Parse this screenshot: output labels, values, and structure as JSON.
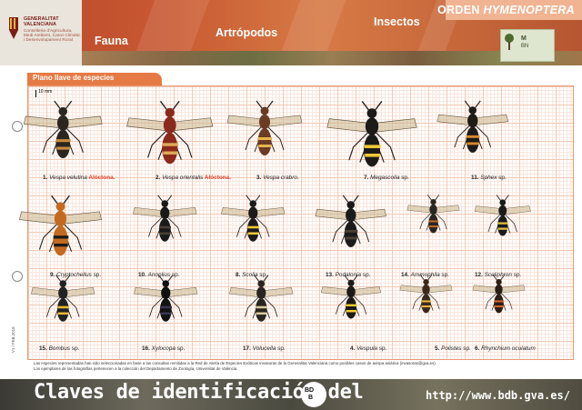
{
  "header": {
    "logo_lines": [
      "GENERALITAT",
      "VALENCIANA"
    ],
    "logo_sub_lines": [
      "Conselleria d'Agricultura,",
      "Medi Ambient, Canvi Climàtic",
      "i Desenvolupament Rural"
    ],
    "crumbs": [
      "Fauna",
      "Artrópodos",
      "Insectos"
    ],
    "orden_prefix": "ORDEN",
    "orden_name": "HYMENOPTERA",
    "museum_lines": [
      "M",
      "BN"
    ]
  },
  "plate": {
    "tab_label": "Plano llave de especies",
    "scale_label": "10 mm"
  },
  "specimens": [
    {
      "num": "1.",
      "genus": "Vespa velutina",
      "suffix": "",
      "alien": "Alóctona.",
      "color": "dark"
    },
    {
      "num": "2.",
      "genus": "Vespa orientalis",
      "suffix": "",
      "alien": "Alóctona.",
      "color": "red"
    },
    {
      "num": "3.",
      "genus": "Vespa crabro.",
      "suffix": "",
      "alien": "",
      "color": "hornet"
    },
    {
      "num": "7.",
      "genus": "Megascolia",
      "suffix": " sp.",
      "alien": "",
      "color": "black-yellow"
    },
    {
      "num": "11.",
      "genus": "Sphex",
      "suffix": " sp.",
      "alien": "",
      "color": "orange-black"
    },
    {
      "num": "9.",
      "genus": "Cryptocheilus",
      "suffix": " sp.",
      "alien": "",
      "color": "orange"
    },
    {
      "num": "10.",
      "genus": "Anoplius",
      "suffix": " sp.",
      "alien": "",
      "color": "black"
    },
    {
      "num": "8.",
      "genus": "Scolia",
      "suffix": " sp.",
      "alien": "",
      "color": "black-yellow"
    },
    {
      "num": "13.",
      "genus": "Podalonia",
      "suffix": " sp.",
      "alien": "",
      "color": "black"
    },
    {
      "num": "14.",
      "genus": "Ammophila",
      "suffix": " sp.",
      "alien": "",
      "color": "thin"
    },
    {
      "num": "12.",
      "genus": "Sceliphron",
      "suffix": " sp.",
      "alien": "",
      "color": "thin-black"
    },
    {
      "num": "15.",
      "genus": "Bombus",
      "suffix": " sp.",
      "alien": "",
      "color": "bumble"
    },
    {
      "num": "16.",
      "genus": "Xylocopa",
      "suffix": " sp.",
      "alien": "",
      "color": "carpenter"
    },
    {
      "num": "17.",
      "genus": "Volucella",
      "suffix": " sp.",
      "alien": "",
      "color": "fly"
    },
    {
      "num": "4.",
      "genus": "Vespula",
      "suffix": " sp.",
      "alien": "",
      "color": "yellowjacket"
    },
    {
      "num": "5.",
      "genus": "Polistes",
      "suffix": " sp.",
      "alien": "",
      "color": "paper"
    },
    {
      "num": "6.",
      "genus": "Rhynchium oculatum",
      "suffix": "",
      "alien": "",
      "color": "potter"
    }
  ],
  "notes": [
    "Las especies representadas han sido seleccionadas en base a las consultas remitidas a la Red de Alerta de Especies Exóticas Invasoras de la Generalitat Valenciana como posibles casos de avispa asiática (invasoras@gva.es).",
    "Los ejemplares de las fotografías pertenecen a la colección del Departamento de Zoología, Universitat de València."
  ],
  "version": "V1 / FEB.2018",
  "footer": {
    "title": "Claves de identificación del",
    "logo_top": "BD",
    "logo_bottom": "B",
    "url": "http://www.bdb.gva.es/"
  }
}
